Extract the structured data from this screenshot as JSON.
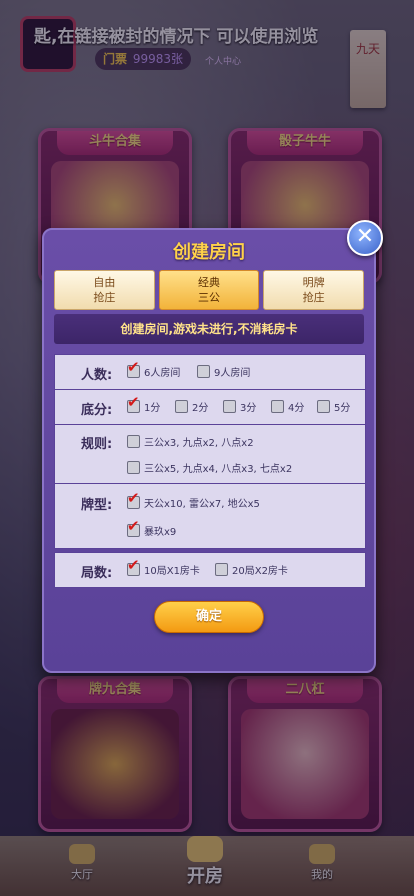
{
  "topbar": {
    "marquee": "匙,在链接被封的情况下 可以使用浏览",
    "ticket_label": "门票",
    "ticket_count": "99983张",
    "user_center": "个人中心",
    "scroll_text": "九天"
  },
  "game_cards": [
    {
      "title": "斗牛合集"
    },
    {
      "title": "骰子牛牛"
    },
    {
      "title": "牌九合集"
    },
    {
      "title": "二八杠"
    }
  ],
  "modal": {
    "title": "创建房间",
    "tabs": [
      {
        "line1": "自由",
        "line2": "抢庄",
        "active": false
      },
      {
        "line1": "经典",
        "line2": "三公",
        "active": true
      },
      {
        "line1": "明牌",
        "line2": "抢庄",
        "active": false
      }
    ],
    "notice": "创建房间,游戏未进行,不消耗房卡",
    "rows": {
      "players": {
        "label": "人数:",
        "options": [
          {
            "text": "6人房间",
            "checked": true
          },
          {
            "text": "9人房间",
            "checked": false
          }
        ]
      },
      "base": {
        "label": "底分:",
        "options": [
          {
            "text": "1分",
            "checked": true
          },
          {
            "text": "2分",
            "checked": false
          },
          {
            "text": "3分",
            "checked": false
          },
          {
            "text": "4分",
            "checked": false
          },
          {
            "text": "5分",
            "checked": false
          }
        ]
      },
      "rules": {
        "label": "规则:",
        "options": [
          {
            "text": "三公x3, 九点x2, 八点x2",
            "checked": false
          },
          {
            "text": "三公x5, 九点x4, 八点x3, 七点x2",
            "checked": false
          }
        ]
      },
      "cards": {
        "label": "牌型:",
        "options": [
          {
            "text": "天公x10, 雷公x7, 地公x5",
            "checked": true
          },
          {
            "text": "暴玖x9",
            "checked": true
          }
        ]
      },
      "rounds": {
        "label": "局数:",
        "options": [
          {
            "text": "10局X1房卡",
            "checked": true
          },
          {
            "text": "20局X2房卡",
            "checked": false
          }
        ]
      }
    },
    "confirm_label": "确定",
    "close_icon": "close-icon"
  },
  "navbar": {
    "lobby": "大厅",
    "open_room": "开房",
    "mine": "我的"
  }
}
